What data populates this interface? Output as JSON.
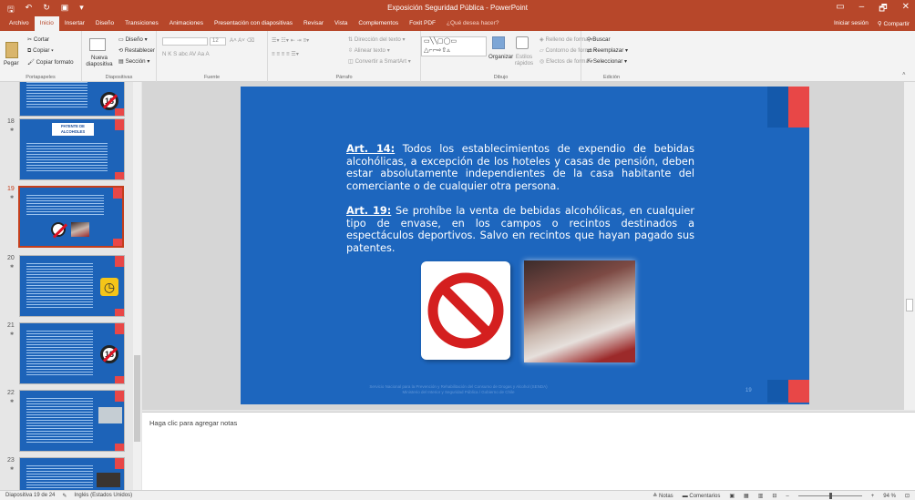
{
  "window": {
    "title": "Exposición Seguridad Pública - PowerPoint",
    "controls": [
      "▭",
      "–",
      "🗗",
      "✕"
    ]
  },
  "tabs": {
    "items": [
      "Archivo",
      "Inicio",
      "Insertar",
      "Diseño",
      "Transiciones",
      "Animaciones",
      "Presentación con diapositivas",
      "Revisar",
      "Vista",
      "Complementos",
      "Foxit PDF"
    ],
    "active": "Inicio",
    "tell_me": "¿Qué desea hacer?",
    "signin": "Iniciar sesión",
    "share": "Compartir"
  },
  "ribbon": {
    "clipboard": {
      "paste": "Pegar",
      "cut": "Cortar",
      "copy": "Copiar",
      "format_painter": "Copiar formato",
      "label": "Portapapeles"
    },
    "slides": {
      "new_slide": "Nueva diapositiva",
      "layout": "Diseño",
      "reset": "Restablecer",
      "section": "Sección",
      "label": "Diapositivas"
    },
    "font": {
      "size": "12",
      "bold": "N",
      "italic": "K",
      "underline": "S",
      "strike": "abc",
      "label": "Fuente"
    },
    "paragraph": {
      "text_direction": "Dirección del texto",
      "align_text": "Alinear texto",
      "smartart": "Convertir a SmartArt",
      "label": "Párrafo"
    },
    "drawing": {
      "arrange": "Organizar",
      "styles": "Estilos rápidos",
      "fill": "Relleno de forma",
      "outline": "Contorno de forma",
      "effects": "Efectos de forma",
      "label": "Dibujo"
    },
    "editing": {
      "find": "Buscar",
      "replace": "Reemplazar",
      "select": "Seleccionar",
      "label": "Edición"
    }
  },
  "thumbnails": {
    "slide17_badge": "18",
    "slide18": {
      "number": "18",
      "heading": "PATENTE DE ALCOHOLES"
    },
    "slide19": {
      "number": "19"
    },
    "slide20": {
      "number": "20"
    },
    "slide21": {
      "number": "21",
      "badge": "18"
    },
    "slide22": {
      "number": "22"
    },
    "slide23": {
      "number": "23"
    }
  },
  "slide": {
    "para1_art": "Art. 14:",
    "para1_text": " Todos los establecimientos de expendio de bebidas alcohólicas, a excepción de los hoteles y casas de pensión, deben estar absolutamente independientes de la casa habitante del comerciante o de cualquier otra persona.",
    "para2_art": "Art. 19:",
    "para2_text": " Se prohíbe la venta de bebidas alcohólicas, en cualquier tipo de envase, en los campos o recintos destinados a espectáculos deportivos. Salvo en recintos que hayan pagado sus patentes.",
    "footer_line1": "Servicio Nacional para la Prevención y Rehabilitación del Consumo de Drogas y Alcohol (SENDA)",
    "footer_line2": "Ministerio del Interior y Seguridad Pública / Gobierno de Chile",
    "page_number": "19"
  },
  "notes": {
    "placeholder": "Haga clic para agregar notas"
  },
  "status": {
    "slide_info": "Diapositiva 19 de 24",
    "language": "Inglés (Estados Unidos)",
    "notes_btn": "Notas",
    "comments_btn": "Comentarios",
    "zoom": "94 %"
  },
  "colors": {
    "accent": "#b7472a",
    "slide_bg": "#1d66be",
    "slide_red": "#e84747"
  }
}
